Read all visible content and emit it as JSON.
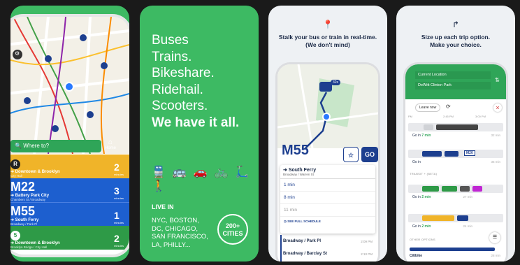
{
  "panel1": {
    "search_placeholder": "Where to?",
    "home_label": "Home",
    "routes": [
      {
        "badge": "R",
        "name": "",
        "dest": "Downtown & Brooklyn",
        "sub": "City Hall",
        "mins": "2",
        "color": "#f0b429"
      },
      {
        "badge": "",
        "name": "M22",
        "dest": "Battery Park City",
        "sub": "Chambers St / Broadway",
        "mins": "3",
        "color": "#1d5fcf"
      },
      {
        "badge": "",
        "name": "M55",
        "dest": "South Ferry",
        "sub": "Broadway / Park Pl",
        "mins": "1",
        "color": "#1d5fcf"
      },
      {
        "badge": "5",
        "name": "",
        "dest": "Downtown & Brooklyn",
        "sub": "Brooklyn Bridge / City Hall",
        "mins": "2",
        "color": "#2e9a47"
      }
    ],
    "minutes_label": "minutes"
  },
  "panel2": {
    "lines": [
      "Buses",
      "Trains.",
      "Bikeshare.",
      "Ridehail.",
      "Scooters."
    ],
    "bold_line": "We have it all.",
    "modes": "🚆🚌🚗🚲🛴🚶",
    "live_in": "LIVE IN",
    "cities": [
      "NYC, BOSTON,",
      "DC, CHICAGO,",
      "SAN FRANCISCO,",
      "LA, PHILLY..."
    ],
    "circle_top": "200+",
    "circle_bottom": "CITIES"
  },
  "panel3": {
    "caption_1": "Stalk your bus or train in real-time.",
    "caption_2": "(We don't mind)",
    "bus_chip": "32s",
    "route": "M55",
    "go": "GO",
    "stop": "South Ferry",
    "stop_sub": "Broadway / Warren St",
    "times": [
      "1 min",
      "8 min",
      "11 min"
    ],
    "schedule": "SEE FULL SCHEDULE",
    "timeline": [
      {
        "stop": "Broadway / Park Pl",
        "time": "2:09 PM"
      },
      {
        "stop": "Broadway / Barclay St",
        "time": "2:10 PM"
      }
    ]
  },
  "panel4": {
    "caption_1": "Size up each trip option.",
    "caption_2": "Make your choice.",
    "from": "Current Location",
    "to": "DeWitt Clinton Park",
    "leave_now": "Leave now",
    "ticks": [
      "PM",
      "2:45 PM",
      "3:00 PM"
    ],
    "options": [
      {
        "text": "Go in",
        "mins": "7 min",
        "dur": "32 min"
      },
      {
        "text": "Go in",
        "mins": "",
        "dur": "36 min",
        "chip": "M20"
      },
      {
        "text": "Go in",
        "mins": "2 min",
        "dur": "27 min"
      },
      {
        "text": "Go in",
        "mins": "2 min",
        "dur": "24 min"
      }
    ],
    "transit_label": "TRANSIT + (BETA)",
    "other_label": "OTHER OPTIONS",
    "citibike": "Citibike",
    "citibike_dur": "28 min"
  }
}
